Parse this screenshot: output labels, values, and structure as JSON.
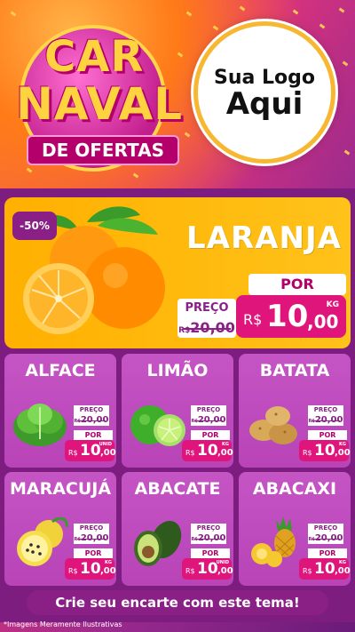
{
  "header": {
    "title_line1": "CAR",
    "title_line2": "NAVAL",
    "ribbon": "DE OFERTAS",
    "logo_line1": "Sua Logo",
    "logo_line2": "Aqui"
  },
  "featured": {
    "discount": "-50%",
    "name": "LARANJA",
    "preco_label": "PREÇO",
    "old_currency": "R$",
    "old_price": "20,00",
    "por_label": "POR",
    "currency": "R$",
    "price_int": "10",
    "price_cents": ",00",
    "unit": "KG"
  },
  "products": [
    {
      "name": "ALFACE",
      "preco_label": "PREÇO",
      "old_currency": "R$",
      "old_price": "20,00",
      "por_label": "POR",
      "currency": "R$",
      "price_int": "10",
      "price_cents": ",00",
      "unit": "UNID"
    },
    {
      "name": "LIMÃO",
      "preco_label": "PREÇO",
      "old_currency": "R$",
      "old_price": "20,00",
      "por_label": "POR",
      "currency": "R$",
      "price_int": "10",
      "price_cents": ",00",
      "unit": "KG"
    },
    {
      "name": "BATATA",
      "preco_label": "PREÇO",
      "old_currency": "R$",
      "old_price": "20,00",
      "por_label": "POR",
      "currency": "R$",
      "price_int": "10",
      "price_cents": ",00",
      "unit": "KG"
    },
    {
      "name": "MARACUJÁ",
      "preco_label": "PREÇO",
      "old_currency": "R$",
      "old_price": "20,00",
      "por_label": "POR",
      "currency": "R$",
      "price_int": "10",
      "price_cents": ",00",
      "unit": "KG"
    },
    {
      "name": "ABACATE",
      "preco_label": "PREÇO",
      "old_currency": "R$",
      "old_price": "20,00",
      "por_label": "POR",
      "currency": "R$",
      "price_int": "10",
      "price_cents": ",00",
      "unit": "UNID"
    },
    {
      "name": "ABACAXI",
      "preco_label": "PREÇO",
      "old_currency": "R$",
      "old_price": "20,00",
      "por_label": "POR",
      "currency": "R$",
      "price_int": "10",
      "price_cents": ",00",
      "unit": "KG"
    }
  ],
  "cta": "Crie seu encarte com este tema!",
  "disclaimer": "*Imagens Meramente Ilustrativas",
  "colors": {
    "purple": "#8a1f86",
    "magenta": "#e0157b",
    "orange_panel": "#ffb000",
    "card": "#c554c4",
    "title_yellow": "#ffd23f"
  }
}
